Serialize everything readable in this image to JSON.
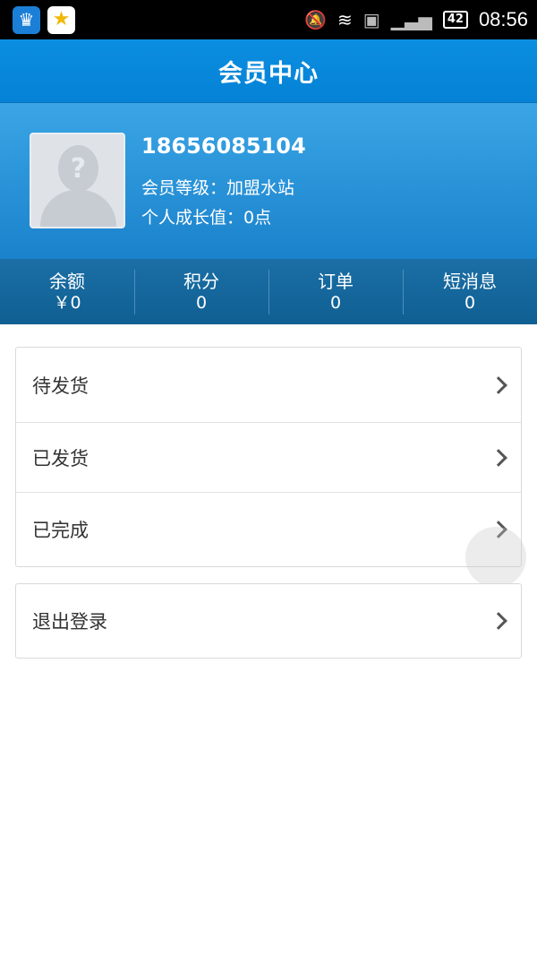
{
  "status_bar": {
    "left_icons": [
      "crown-app-icon",
      "star-app-icon"
    ],
    "battery": "42",
    "time": "08:56"
  },
  "header": {
    "title": "会员中心"
  },
  "profile": {
    "phone": "18656085104",
    "level_line": "会员等级：加盟水站",
    "growth_line": "个人成长值：0点",
    "avatar_glyph": "?"
  },
  "stats": [
    {
      "label": "余额",
      "value": "￥0"
    },
    {
      "label": "积分",
      "value": "0"
    },
    {
      "label": "订单",
      "value": "0"
    },
    {
      "label": "短消息",
      "value": "0"
    }
  ],
  "orders": [
    {
      "label": "待发货"
    },
    {
      "label": "已发货"
    },
    {
      "label": "已完成"
    }
  ],
  "logout": {
    "label": "退出登录"
  },
  "colors": {
    "title_bar": "#0b8ee0",
    "profile_bg": "#2a94d8",
    "stats_bg": "#16679c"
  }
}
